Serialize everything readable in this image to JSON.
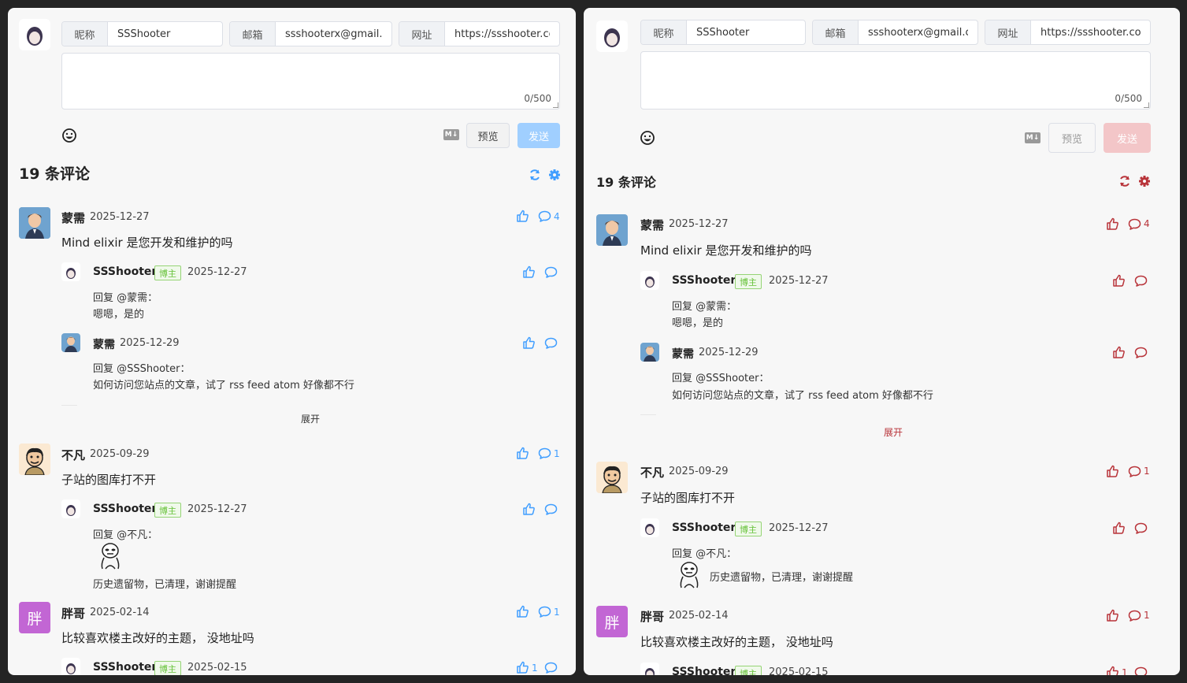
{
  "form": {
    "nick_label": "昵称",
    "nick_value": "SSShooter",
    "email_label": "邮箱",
    "email_value": "ssshooterx@gmail.com",
    "url_label": "网址",
    "url_value": "https://ssshooter.com",
    "char_count": "0/500",
    "preview_label": "预览",
    "send_label": "发送"
  },
  "count_title": "19 条评论",
  "comments": [
    {
      "name": "蒙需",
      "date": "2025-12-27",
      "text": "Mind elixir 是您开发和维护的吗",
      "reply_count": "4",
      "replies": [
        {
          "name": "SSShooter",
          "badge": "博主",
          "date": "2025-12-27",
          "reply_to": "回复 @蒙需：",
          "text": "嗯嗯，是的"
        },
        {
          "name": "蒙需",
          "date": "2025-12-29",
          "reply_to": "回复 @SSShooter：",
          "text": "如何访问您站点的文章，试了 rss feed atom 好像都不行"
        }
      ],
      "expand_label": "展开"
    },
    {
      "name": "不凡",
      "date": "2025-09-29",
      "text": "子站的图库打不开",
      "reply_count": "1",
      "replies": [
        {
          "name": "SSShooter",
          "badge": "博主",
          "date": "2025-12-27",
          "reply_to": "回复 @不凡：",
          "text": "历史遗留物，已清理，谢谢提醒"
        }
      ]
    },
    {
      "name": "胖哥",
      "avatar_char": "胖",
      "date": "2025-02-14",
      "text": "比较喜欢楼主改好的主题， 没地址吗",
      "reply_count": "1",
      "replies": [
        {
          "name": "SSShooter",
          "badge": "博主",
          "date": "2025-02-15",
          "like_count": "1"
        }
      ]
    }
  ],
  "icons": {
    "emoji": "smile-icon",
    "markdown": "markdown-icon",
    "markdown_text": "M↓",
    "refresh": "refresh-icon",
    "settings": "gear-icon",
    "like": "thumbs-up-icon",
    "comment": "comment-bubble-icon"
  },
  "themes": {
    "left": {
      "accent": "#409eff",
      "send_bg": "#a0cfff"
    },
    "right": {
      "accent": "#b8343a",
      "send_bg": "#f3c6c8"
    }
  }
}
